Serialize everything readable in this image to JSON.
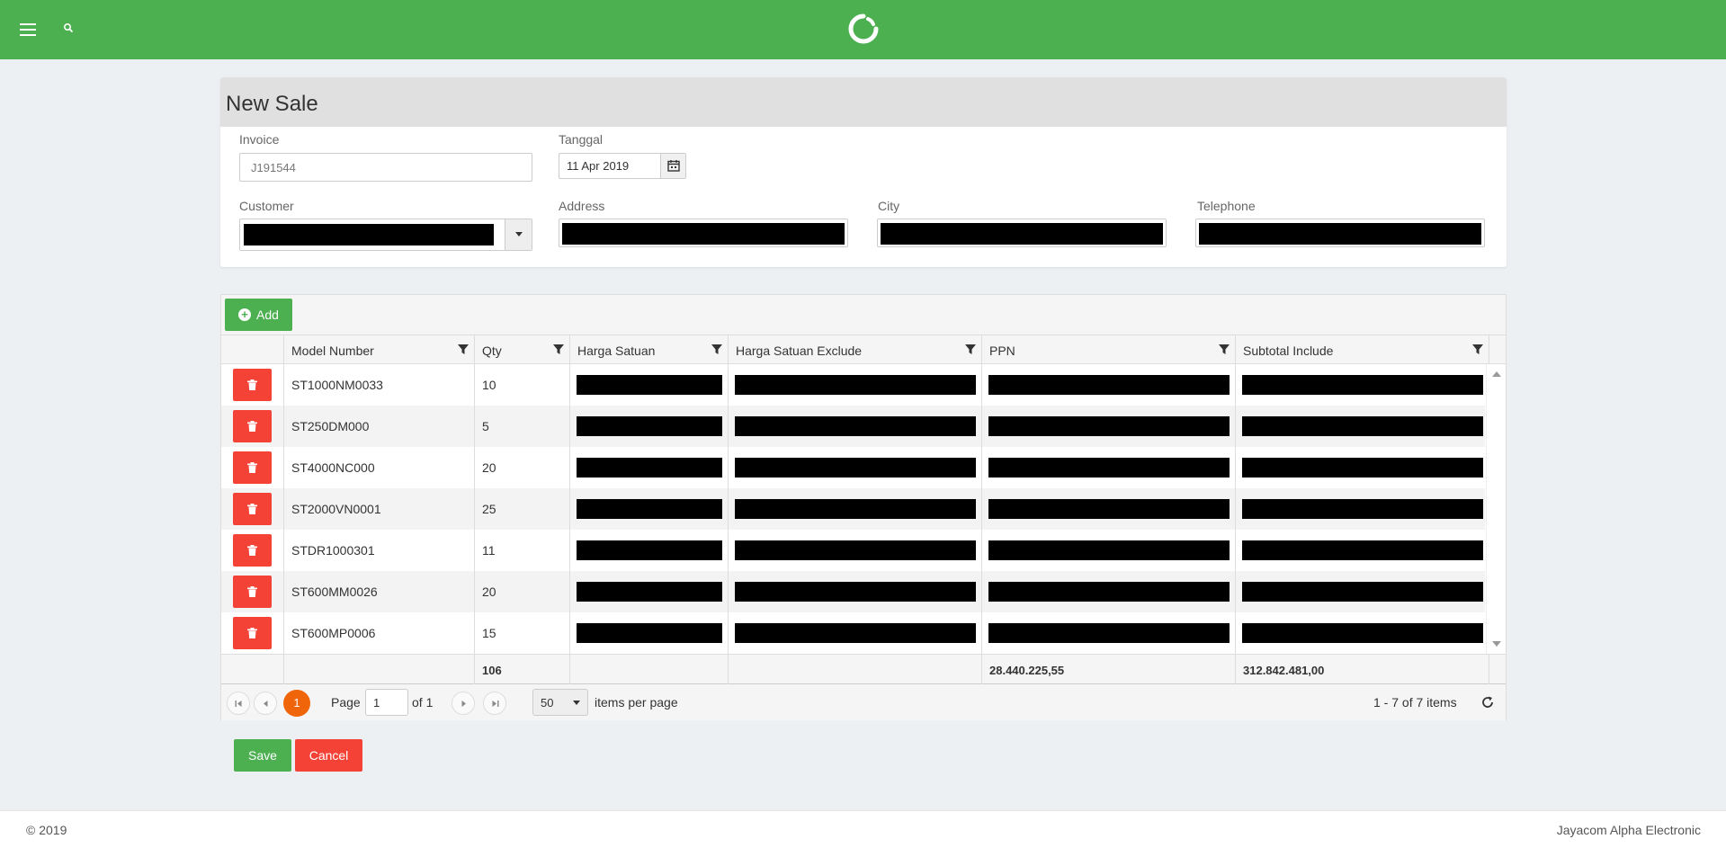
{
  "page": {
    "title": "New Sale"
  },
  "form": {
    "invoice_label": "Invoice",
    "invoice_placeholder": "J191544",
    "date_label": "Tanggal",
    "date_value": "11 Apr 2019",
    "customer_label": "Customer",
    "address_label": "Address",
    "city_label": "City",
    "telephone_label": "Telephone"
  },
  "grid": {
    "add_label": "Add",
    "columns": [
      "Model Number",
      "Qty",
      "Harga Satuan",
      "Harga Satuan Exclude",
      "PPN",
      "Subtotal Include"
    ],
    "rows": [
      {
        "model": "ST1000NM0033",
        "qty": "10"
      },
      {
        "model": "ST250DM000",
        "qty": "5"
      },
      {
        "model": "ST4000NC000",
        "qty": "20"
      },
      {
        "model": "ST2000VN0001",
        "qty": "25"
      },
      {
        "model": "STDR1000301",
        "qty": "11"
      },
      {
        "model": "ST600MM0026",
        "qty": "20"
      },
      {
        "model": "ST600MP0006",
        "qty": "15"
      }
    ],
    "totals": {
      "qty": "106",
      "ppn": "28.440.225,55",
      "subtotal": "312.842.481,00"
    }
  },
  "pager": {
    "current": "1",
    "page_label": "Page",
    "page_value": "1",
    "of_label": "of 1",
    "page_size": "50",
    "per_page_label": "items per page",
    "summary": "1 - 7 of 7 items"
  },
  "actions": {
    "save_label": "Save",
    "cancel_label": "Cancel"
  },
  "footer": {
    "copyright": "© 2019",
    "company": "Jayacom Alpha Electronic"
  },
  "colors": {
    "brand": "#4caf50",
    "danger": "#f44336",
    "accent": "#f0640a"
  }
}
